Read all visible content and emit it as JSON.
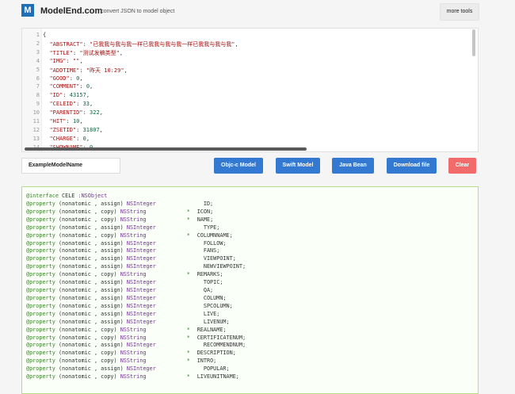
{
  "header": {
    "logo_letter": "M",
    "brand": "ModelEnd.com",
    "tagline": "- convert JSON to model object",
    "more_tools_label": "more tools"
  },
  "editor": {
    "line_numbers": [
      "1",
      "2",
      "3",
      "4",
      "5",
      "6",
      "7",
      "8",
      "9",
      "10",
      "11",
      "12",
      "13",
      "14"
    ],
    "lines": [
      [
        {
          "t": "{",
          "c": "punct"
        }
      ],
      [
        {
          "t": "  ",
          "c": "punct"
        },
        {
          "t": "\"ABSTRACT\"",
          "c": "key"
        },
        {
          "t": ": ",
          "c": "punct"
        },
        {
          "t": "\"已我我与我与我一样已我我与我与我一样已我我与我与我\"",
          "c": "str"
        },
        {
          "t": ",",
          "c": "punct"
        }
      ],
      [
        {
          "t": "  ",
          "c": "punct"
        },
        {
          "t": "\"TITLE\"",
          "c": "key"
        },
        {
          "t": ": ",
          "c": "punct"
        },
        {
          "t": "\"测试发稿类型\"",
          "c": "str"
        },
        {
          "t": ",",
          "c": "punct"
        }
      ],
      [
        {
          "t": "  ",
          "c": "punct"
        },
        {
          "t": "\"IMG\"",
          "c": "key"
        },
        {
          "t": ": ",
          "c": "punct"
        },
        {
          "t": "\"\"",
          "c": "str"
        },
        {
          "t": ",",
          "c": "punct"
        }
      ],
      [
        {
          "t": "  ",
          "c": "punct"
        },
        {
          "t": "\"ADDTIME\"",
          "c": "key"
        },
        {
          "t": ": ",
          "c": "punct"
        },
        {
          "t": "\"昨天 10:29\"",
          "c": "str"
        },
        {
          "t": ",",
          "c": "punct"
        }
      ],
      [
        {
          "t": "  ",
          "c": "punct"
        },
        {
          "t": "\"GOOD\"",
          "c": "key"
        },
        {
          "t": ": ",
          "c": "punct"
        },
        {
          "t": "0",
          "c": "num"
        },
        {
          "t": ",",
          "c": "punct"
        }
      ],
      [
        {
          "t": "  ",
          "c": "punct"
        },
        {
          "t": "\"COMMENT\"",
          "c": "key"
        },
        {
          "t": ": ",
          "c": "punct"
        },
        {
          "t": "0",
          "c": "num"
        },
        {
          "t": ",",
          "c": "punct"
        }
      ],
      [
        {
          "t": "  ",
          "c": "punct"
        },
        {
          "t": "\"ID\"",
          "c": "key"
        },
        {
          "t": ": ",
          "c": "punct"
        },
        {
          "t": "43157",
          "c": "num"
        },
        {
          "t": ",",
          "c": "punct"
        }
      ],
      [
        {
          "t": "  ",
          "c": "punct"
        },
        {
          "t": "\"CELEID\"",
          "c": "key"
        },
        {
          "t": ": ",
          "c": "punct"
        },
        {
          "t": "33",
          "c": "num"
        },
        {
          "t": ",",
          "c": "punct"
        }
      ],
      [
        {
          "t": "  ",
          "c": "punct"
        },
        {
          "t": "\"PARENTID\"",
          "c": "key"
        },
        {
          "t": ": ",
          "c": "punct"
        },
        {
          "t": "322",
          "c": "num"
        },
        {
          "t": ",",
          "c": "punct"
        }
      ],
      [
        {
          "t": "  ",
          "c": "punct"
        },
        {
          "t": "\"HIT\"",
          "c": "key"
        },
        {
          "t": ": ",
          "c": "punct"
        },
        {
          "t": "10",
          "c": "num"
        },
        {
          "t": ",",
          "c": "punct"
        }
      ],
      [
        {
          "t": "  ",
          "c": "punct"
        },
        {
          "t": "\"ZSETID\"",
          "c": "key"
        },
        {
          "t": ": ",
          "c": "punct"
        },
        {
          "t": "31807",
          "c": "num"
        },
        {
          "t": ",",
          "c": "punct"
        }
      ],
      [
        {
          "t": "  ",
          "c": "punct"
        },
        {
          "t": "\"CHARGE\"",
          "c": "key"
        },
        {
          "t": ": ",
          "c": "punct"
        },
        {
          "t": "0",
          "c": "num"
        },
        {
          "t": ",",
          "c": "punct"
        }
      ],
      [
        {
          "t": "  ",
          "c": "punct"
        },
        {
          "t": "\"SHOWNAME\"",
          "c": "key"
        },
        {
          "t": ": ",
          "c": "punct"
        },
        {
          "t": "0",
          "c": "num"
        }
      ]
    ]
  },
  "controls": {
    "model_name": "ExampleModelName",
    "buttons": {
      "objc": "Objc-c Model",
      "swift": "Swift Model",
      "java": "Java Bean",
      "download": "Download file",
      "clear": "Clear"
    }
  },
  "output": {
    "interface_line": {
      "kw": "@interface",
      "name": " CELE ",
      "super": ":NSObject"
    },
    "properties": [
      {
        "mods": "(nonatomic , assign)",
        "type": "NSInteger",
        "star": false,
        "name": "ID;"
      },
      {
        "mods": "(nonatomic , copy)",
        "type": "NSString",
        "star": true,
        "name": "ICON;"
      },
      {
        "mods": "(nonatomic , copy)",
        "type": "NSString",
        "star": true,
        "name": "NAME;"
      },
      {
        "mods": "(nonatomic , assign)",
        "type": "NSInteger",
        "star": false,
        "name": "TYPE;"
      },
      {
        "mods": "(nonatomic , copy)",
        "type": "NSString",
        "star": true,
        "name": "COLUMNNAME;"
      },
      {
        "mods": "(nonatomic , assign)",
        "type": "NSInteger",
        "star": false,
        "name": "FOLLOW;"
      },
      {
        "mods": "(nonatomic , assign)",
        "type": "NSInteger",
        "star": false,
        "name": "FANS;"
      },
      {
        "mods": "(nonatomic , assign)",
        "type": "NSInteger",
        "star": false,
        "name": "VIEWPOINT;"
      },
      {
        "mods": "(nonatomic , assign)",
        "type": "NSInteger",
        "star": false,
        "name": "NEWVIEWPOINT;"
      },
      {
        "mods": "(nonatomic , copy)",
        "type": "NSString",
        "star": true,
        "name": "REMARKS;"
      },
      {
        "mods": "(nonatomic , assign)",
        "type": "NSInteger",
        "star": false,
        "name": "TOPIC;"
      },
      {
        "mods": "(nonatomic , assign)",
        "type": "NSInteger",
        "star": false,
        "name": "QA;"
      },
      {
        "mods": "(nonatomic , assign)",
        "type": "NSInteger",
        "star": false,
        "name": "COLUMN;"
      },
      {
        "mods": "(nonatomic , assign)",
        "type": "NSInteger",
        "star": false,
        "name": "SPCOLUMN;"
      },
      {
        "mods": "(nonatomic , assign)",
        "type": "NSInteger",
        "star": false,
        "name": "LIVE;"
      },
      {
        "mods": "(nonatomic , assign)",
        "type": "NSInteger",
        "star": false,
        "name": "LIVENUM;"
      },
      {
        "mods": "(nonatomic , copy)",
        "type": "NSString",
        "star": true,
        "name": "REALNAME;"
      },
      {
        "mods": "(nonatomic , copy)",
        "type": "NSString",
        "star": true,
        "name": "CERTIFICATENUM;"
      },
      {
        "mods": "(nonatomic , assign)",
        "type": "NSInteger",
        "star": false,
        "name": "RECOMMENDNUM;"
      },
      {
        "mods": "(nonatomic , copy)",
        "type": "NSString",
        "star": true,
        "name": "DESCRIPTION;"
      },
      {
        "mods": "(nonatomic , copy)",
        "type": "NSString",
        "star": true,
        "name": "INTRO;"
      },
      {
        "mods": "(nonatomic , assign)",
        "type": "NSInteger",
        "star": false,
        "name": "POPULAR;"
      },
      {
        "mods": "(nonatomic , copy)",
        "type": "NSString",
        "star": true,
        "name": "LIVEUNITNAME;"
      }
    ]
  },
  "colors": {
    "brand_blue": "#1f6fb6",
    "button_blue": "#3479d1",
    "button_red": "#f26b6b",
    "output_border": "#b7de86"
  }
}
